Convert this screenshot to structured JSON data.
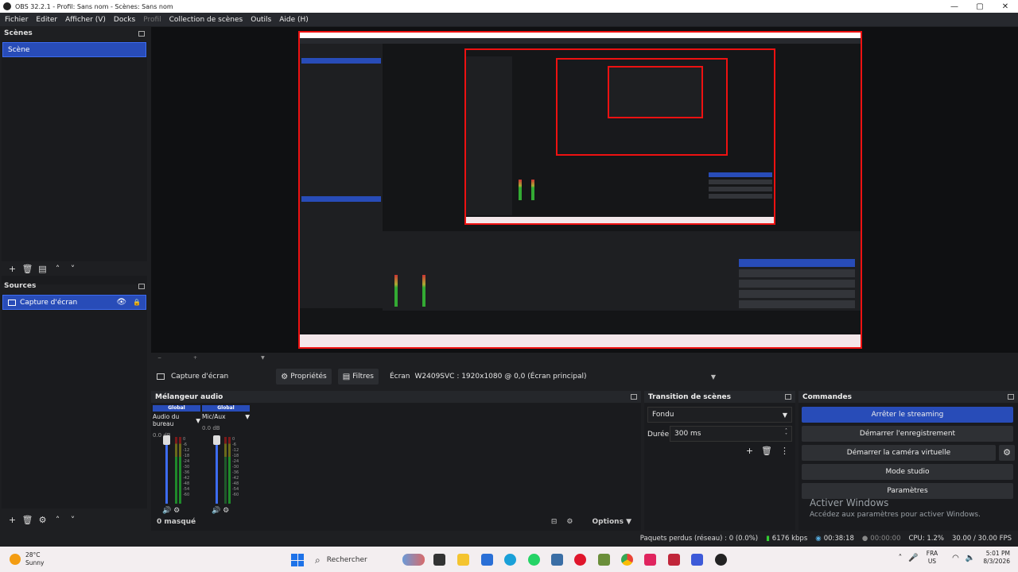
{
  "window": {
    "title": "OBS 32.2.1 - Profil: Sans nom - Scènes: Sans nom",
    "controls": [
      "—",
      "▢",
      "✕"
    ]
  },
  "menu": [
    "Fichier",
    "Editer",
    "Afficher (V)",
    "Docks",
    "Profil",
    "Collection de scènes",
    "Outils",
    "Aide (H)"
  ],
  "scenes": {
    "title": "Scènes",
    "items": [
      "Scène"
    ]
  },
  "sources": {
    "title": "Sources",
    "items": [
      {
        "label": "Capture d'écran"
      }
    ]
  },
  "source_bar": {
    "source_name": "Capture d'écran",
    "properties": "Propriétés",
    "filters": "Filtres",
    "screen_label": "Écran",
    "screen_value": "W2409SVC    : 1920x1080 @ 0,0 (Écran principal)"
  },
  "mixer": {
    "title": "Mélangeur audio",
    "channels": [
      {
        "global": "Global",
        "name": "Audio du bureau",
        "db": "0.0 dB"
      },
      {
        "global": "Global",
        "name": "Mic/Aux",
        "db": "0.0 dB"
      }
    ],
    "scale": [
      "0",
      "-6",
      "-12",
      "-18",
      "-24",
      "-30",
      "-36",
      "-42",
      "-48",
      "-54",
      "-60"
    ],
    "masked": "0 masqué",
    "options": "Options"
  },
  "transition": {
    "title": "Transition de scènes",
    "type": "Fondu",
    "duration_label": "Durée",
    "duration_value": "300 ms"
  },
  "commands": {
    "title": "Commandes",
    "stream": "Arrêter le streaming",
    "record": "Démarrer l'enregistrement",
    "virtualcam": "Démarrer la caméra virtuelle",
    "studio": "Mode studio",
    "settings": "Paramètres",
    "watermark_title": "Activer Windows",
    "watermark_sub": "Accédez aux paramètres pour activer Windows."
  },
  "status": {
    "dropped": "Paquets perdus (réseau) : 0 (0.0%)",
    "bitrate": "6176 kbps",
    "stream_time": "00:38:18",
    "rec_time": "00:00:00",
    "cpu": "CPU: 1.2%",
    "fps": "30.00 / 30.00 FPS"
  },
  "taskbar": {
    "weather_temp": "28°C",
    "weather_desc": "Sunny",
    "search": "Rechercher",
    "lang_top": "FRA",
    "lang_bottom": "US",
    "time": "5:01 PM",
    "date": "8/3/2026"
  },
  "colors": {
    "accent": "#284cb8",
    "preview_border": "#e11111",
    "background": "#1e1f22"
  }
}
